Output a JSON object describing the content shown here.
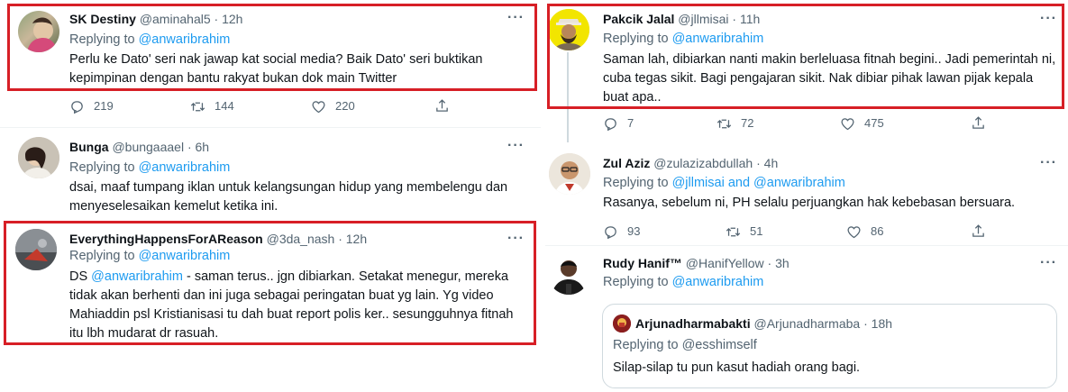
{
  "left": {
    "tweets": [
      {
        "name": "SK Destiny",
        "handle": "@aminahal5",
        "time": "· 12h",
        "replying_prefix": "Replying to ",
        "replying_to": "@anwaribrahim",
        "text": "Perlu ke Dato' seri nak jawap kat social media? Baik Dato' seri buktikan kepimpinan dengan bantu rakyat bukan dok main Twitter",
        "replies": "219",
        "retweets": "144",
        "likes": "220"
      },
      {
        "name": "Bunga",
        "handle": "@bungaaael",
        "time": "· 6h",
        "replying_prefix": "Replying to ",
        "replying_to": "@anwaribrahim",
        "text": "dsai, maaf tumpang iklan untuk kelangsungan hidup yang membelengu dan menyeselesaikan kemelut ketika ini."
      },
      {
        "name": "EverythingHappensForAReason",
        "handle": "@3da_nash",
        "time": "· 12h",
        "replying_prefix": "Replying to ",
        "replying_to": "@anwaribrahim",
        "text_prefix": "DS ",
        "text_mention": "@anwaribrahim",
        "text": " - saman terus.. jgn dibiarkan. Setakat menegur, mereka tidak akan berhenti dan ini juga sebagai peringatan buat yg lain. Yg video Mahiaddin psl Kristianisasi tu dah buat report polis ker.. sesungguhnya fitnah itu lbh mudarat dr rasuah."
      }
    ]
  },
  "right": {
    "tweets": [
      {
        "name": "Pakcik Jalal",
        "handle": "@jllmisai",
        "time": "· 11h",
        "replying_prefix": "Replying to ",
        "replying_to": "@anwaribrahim",
        "text": "Saman lah, dibiarkan nanti makin berleluasa fitnah begini.. Jadi pemerintah ni, cuba tegas sikit. Bagi pengajaran sikit. Nak dibiar pihak lawan pijak kepala buat apa..",
        "replies": "7",
        "retweets": "72",
        "likes": "475"
      },
      {
        "name": "Zul Aziz",
        "handle": "@zulazizabdullah",
        "time": "· 4h",
        "replying_prefix": "Replying to ",
        "replying_to": "@jllmisai and @anwaribrahim",
        "text": "Rasanya, sebelum ni, PH selalu perjuangkan hak kebebasan bersuara.",
        "replies": "93",
        "retweets": "51",
        "likes": "86"
      },
      {
        "name": "Rudy Hanif™",
        "handle": "@HanifYellow",
        "time": "· 3h",
        "replying_prefix": "Replying to ",
        "replying_to": "@anwaribrahim",
        "quote": {
          "name": "Arjunadharmabakti",
          "handle": "@Arjunadharmaba",
          "time": "· 18h",
          "replying_prefix": "Replying to ",
          "replying_to": "@esshimself",
          "text": "Silap-silap tu pun kasut hadiah orang bagi."
        }
      }
    ]
  },
  "more_label": "···",
  "colors": {
    "highlight": "#d71f26",
    "link": "#1d9bf0",
    "secondary": "#536471"
  },
  "icons": [
    "reply-icon",
    "retweet-icon",
    "like-icon",
    "share-icon",
    "more-icon"
  ]
}
